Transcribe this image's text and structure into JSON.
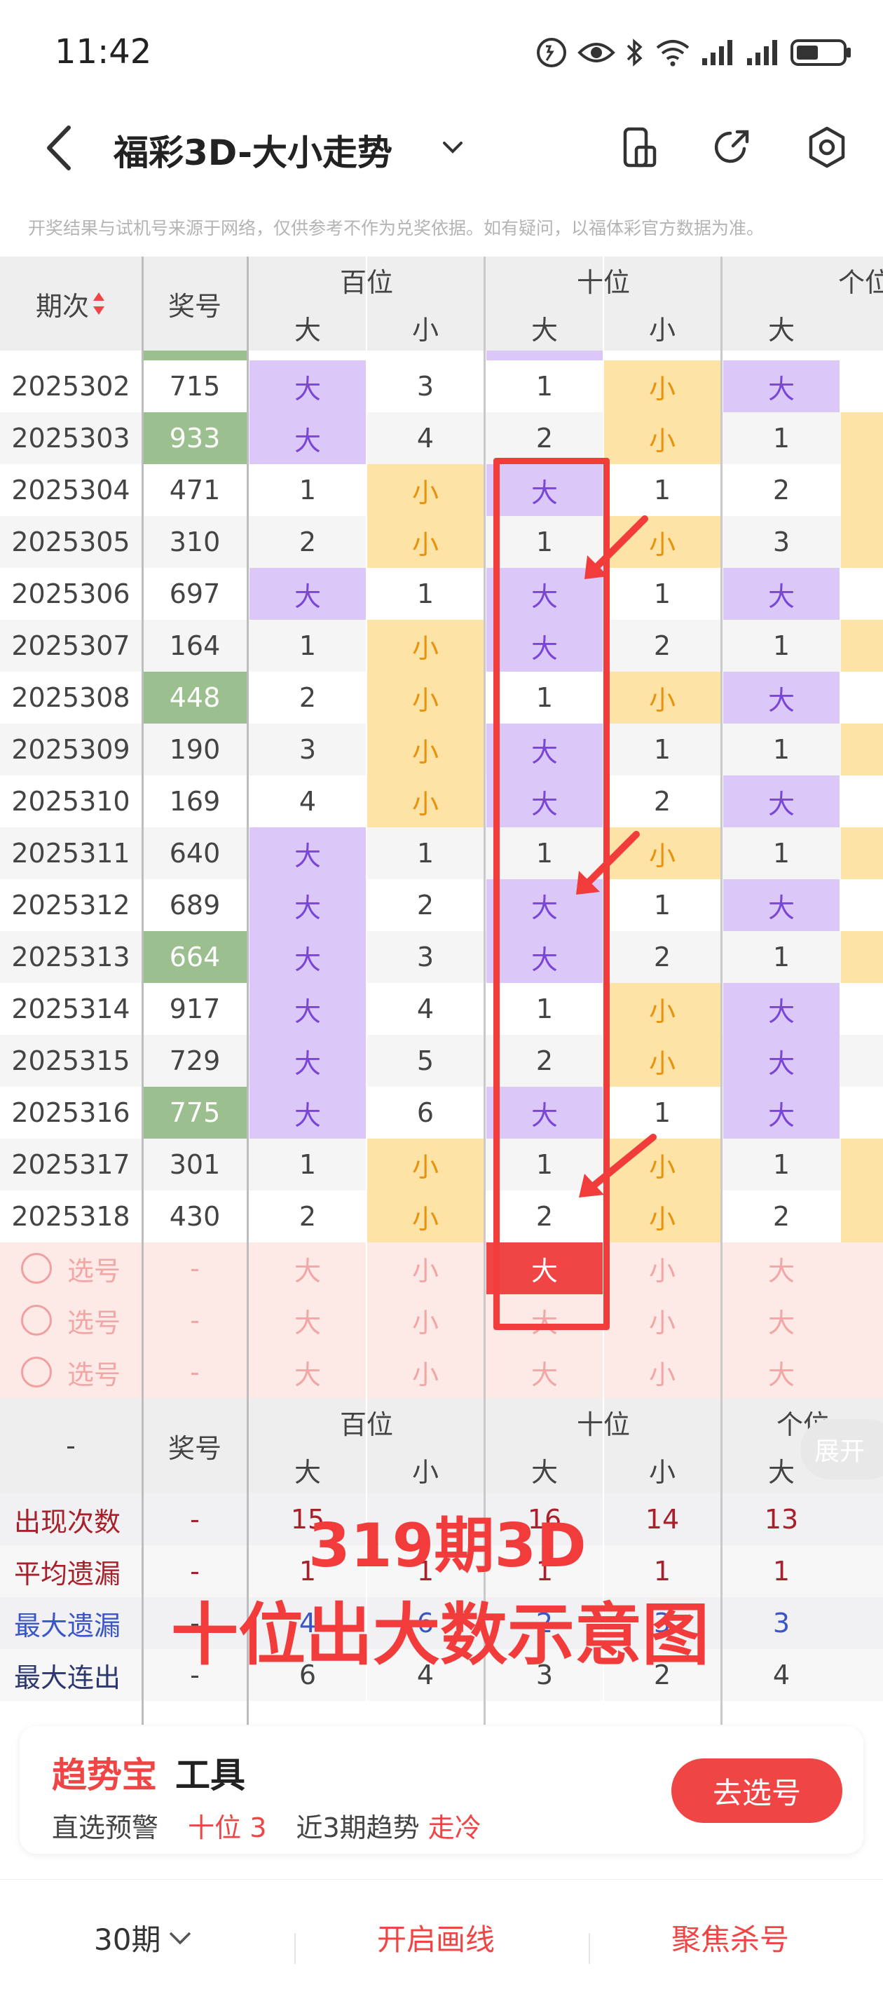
{
  "status": {
    "time": "11:42"
  },
  "header": {
    "title": "福彩3D-大小走势"
  },
  "disclaimer": "开奖结果与试机号来源于网络，仅供参考不作为兑奖依据。如有疑问，以福体彩官方数据为准。",
  "table_header": {
    "period": "期次",
    "number": "奖号",
    "hundreds": "百位",
    "tens": "十位",
    "units": "个位",
    "big": "大",
    "small": "小"
  },
  "rows": [
    {
      "period": "2025302",
      "num": "715",
      "hl": false,
      "h": [
        "big",
        "3"
      ],
      "t": [
        "1",
        "small"
      ],
      "u": [
        "big",
        ""
      ]
    },
    {
      "period": "2025303",
      "num": "933",
      "hl": true,
      "h": [
        "big",
        "4"
      ],
      "t": [
        "2",
        "small"
      ],
      "u": [
        "1",
        "small-bar"
      ]
    },
    {
      "period": "2025304",
      "num": "471",
      "hl": false,
      "h": [
        "1",
        "small"
      ],
      "t": [
        "big",
        "1"
      ],
      "u": [
        "2",
        "small-bar"
      ]
    },
    {
      "period": "2025305",
      "num": "310",
      "hl": false,
      "h": [
        "2",
        "small"
      ],
      "t": [
        "1",
        "small"
      ],
      "u": [
        "3",
        "small-bar"
      ]
    },
    {
      "period": "2025306",
      "num": "697",
      "hl": false,
      "h": [
        "big",
        "1"
      ],
      "t": [
        "big",
        "1"
      ],
      "u": [
        "big",
        ""
      ]
    },
    {
      "period": "2025307",
      "num": "164",
      "hl": false,
      "h": [
        "1",
        "small"
      ],
      "t": [
        "big",
        "2"
      ],
      "u": [
        "1",
        "small-bar"
      ]
    },
    {
      "period": "2025308",
      "num": "448",
      "hl": true,
      "h": [
        "2",
        "small"
      ],
      "t": [
        "1",
        "small"
      ],
      "u": [
        "big",
        ""
      ]
    },
    {
      "period": "2025309",
      "num": "190",
      "hl": false,
      "h": [
        "3",
        "small"
      ],
      "t": [
        "big",
        "1"
      ],
      "u": [
        "1",
        "small-bar"
      ]
    },
    {
      "period": "2025310",
      "num": "169",
      "hl": false,
      "h": [
        "4",
        "small"
      ],
      "t": [
        "big",
        "2"
      ],
      "u": [
        "big",
        ""
      ]
    },
    {
      "period": "2025311",
      "num": "640",
      "hl": false,
      "h": [
        "big",
        "1"
      ],
      "t": [
        "1",
        "small"
      ],
      "u": [
        "1",
        "small-bar"
      ]
    },
    {
      "period": "2025312",
      "num": "689",
      "hl": false,
      "h": [
        "big",
        "2"
      ],
      "t": [
        "big",
        "1"
      ],
      "u": [
        "big",
        ""
      ]
    },
    {
      "period": "2025313",
      "num": "664",
      "hl": true,
      "h": [
        "big",
        "3"
      ],
      "t": [
        "big",
        "2"
      ],
      "u": [
        "1",
        "small-bar"
      ]
    },
    {
      "period": "2025314",
      "num": "917",
      "hl": false,
      "h": [
        "big",
        "4"
      ],
      "t": [
        "1",
        "small"
      ],
      "u": [
        "big",
        ""
      ]
    },
    {
      "period": "2025315",
      "num": "729",
      "hl": false,
      "h": [
        "big",
        "5"
      ],
      "t": [
        "2",
        "small"
      ],
      "u": [
        "big",
        ""
      ]
    },
    {
      "period": "2025316",
      "num": "775",
      "hl": true,
      "h": [
        "big",
        "6"
      ],
      "t": [
        "big",
        "1"
      ],
      "u": [
        "big",
        ""
      ]
    },
    {
      "period": "2025317",
      "num": "301",
      "hl": false,
      "h": [
        "1",
        "small"
      ],
      "t": [
        "1",
        "small"
      ],
      "u": [
        "1",
        "small-bar"
      ]
    },
    {
      "period": "2025318",
      "num": "430",
      "hl": false,
      "h": [
        "2",
        "small"
      ],
      "t": [
        "2",
        "small"
      ],
      "u": [
        "2",
        "small-bar"
      ]
    }
  ],
  "select_rows": {
    "label": "选号",
    "dash": "-",
    "big": "大",
    "small": "小"
  },
  "stats_header": {
    "dash": "-",
    "number": "奖号",
    "hundreds": "百位",
    "tens": "十位",
    "units": "个位",
    "big": "大",
    "small": "小",
    "expand": "展开"
  },
  "stats": [
    {
      "label": "出现次数",
      "dash": "-",
      "vals": [
        "15",
        "",
        "16",
        "14",
        "13"
      ],
      "style": "red"
    },
    {
      "label": "平均遗漏",
      "dash": "-",
      "vals": [
        "1",
        "1",
        "1",
        "1",
        "1"
      ],
      "style": "red"
    },
    {
      "label": "最大遗漏",
      "dash": "-",
      "vals": [
        "4",
        "6",
        "2",
        "3",
        "3"
      ],
      "style": "blue"
    },
    {
      "label": "最大连出",
      "dash": "-",
      "vals": [
        "6",
        "4",
        "3",
        "2",
        "4"
      ],
      "style": "dark"
    }
  ],
  "overlay": {
    "line1": "319期3D",
    "line2": "十位出大数示意图"
  },
  "card": {
    "title_red": "趋势宝",
    "title_dark": "工具",
    "line_a": "直选预警",
    "line_b": "十位 3",
    "line_c": "近3期趋势",
    "line_d": "走冷",
    "button": "去选号"
  },
  "bottom": {
    "periods": "30期",
    "draw": "开启画线",
    "focus": "聚焦杀号"
  },
  "colors": {
    "accent": "#ef4545",
    "big_bg": "#dcc8f8",
    "small_bg": "#fde3a6",
    "hl_num": "#9bbf8e"
  }
}
